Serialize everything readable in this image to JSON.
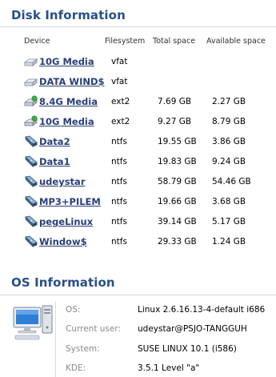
{
  "disk_section": {
    "title": "Disk Information",
    "columns": {
      "device": "Device",
      "filesystem": "Filesystem",
      "total": "Total space",
      "available": "Available space"
    },
    "rows": [
      {
        "name": "10G Media",
        "icon": "removable-drive-icon",
        "filesystem": "vfat",
        "total": "",
        "available": ""
      },
      {
        "name": "DATA WIND$",
        "icon": "removable-drive-icon",
        "filesystem": "vfat",
        "total": "",
        "available": ""
      },
      {
        "name": "8.4G Media",
        "icon": "mounted-drive-icon",
        "filesystem": "ext2",
        "total": "7.69 GB",
        "available": "2.27 GB"
      },
      {
        "name": "10G Media",
        "icon": "mounted-drive-icon",
        "filesystem": "ext2",
        "total": "9.27 GB",
        "available": "8.79 GB"
      },
      {
        "name": "Data2",
        "icon": "harddisk-icon",
        "filesystem": "ntfs",
        "total": "19.55 GB",
        "available": "3.86 GB"
      },
      {
        "name": "Data1",
        "icon": "harddisk-icon",
        "filesystem": "ntfs",
        "total": "19.83 GB",
        "available": "9.24 GB"
      },
      {
        "name": "udeystar",
        "icon": "harddisk-icon",
        "filesystem": "ntfs",
        "total": "58.79 GB",
        "available": "54.46 GB"
      },
      {
        "name": "MP3+PILEM",
        "icon": "harddisk-icon",
        "filesystem": "ntfs",
        "total": "19.66 GB",
        "available": "3.68 GB"
      },
      {
        "name": "pegeLinux",
        "icon": "harddisk-icon",
        "filesystem": "ntfs",
        "total": "39.14 GB",
        "available": "5.17 GB"
      },
      {
        "name": "Window$",
        "icon": "harddisk-icon",
        "filesystem": "ntfs",
        "total": "29.33 GB",
        "available": "1.24 GB"
      }
    ]
  },
  "os_section": {
    "title": "OS Information",
    "icon": "computer-icon",
    "fields": [
      {
        "label": "OS:",
        "value": "Linux 2.6.16.13-4-default i686"
      },
      {
        "label": "Current user:",
        "value": "udeystar@PSJO-TANGGUH"
      },
      {
        "label": "System:",
        "value": "SUSE LINUX 10.1 (i586)"
      },
      {
        "label": "KDE:",
        "value": "3.5.1 Level \"a\""
      }
    ]
  },
  "colors": {
    "section_title": "#2a4f86",
    "link": "#2a3f7a",
    "rule": "#cfd6e2",
    "muted_label": "#8a8a8a"
  }
}
